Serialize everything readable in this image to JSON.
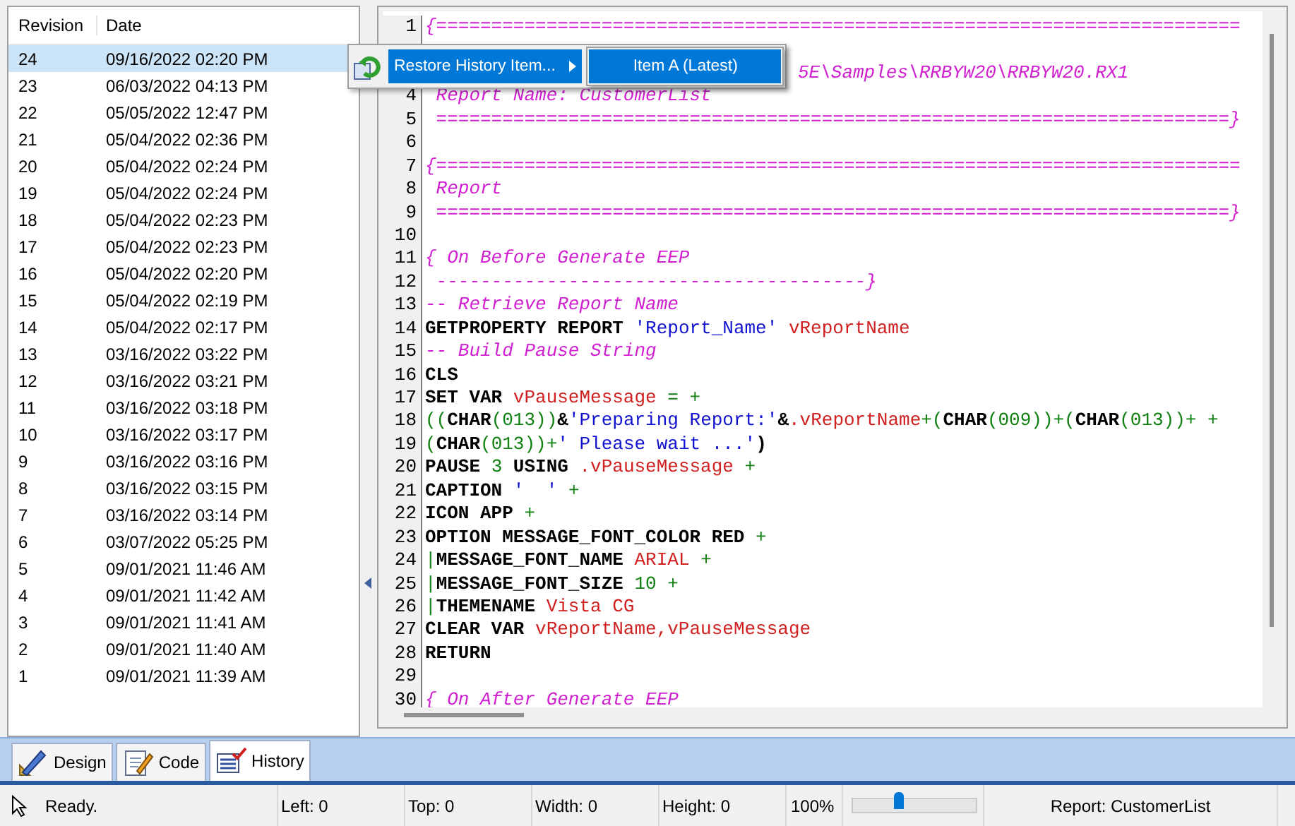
{
  "history": {
    "columns": [
      "Revision",
      "Date"
    ],
    "rows": [
      {
        "revision": "24",
        "date": "09/16/2022 02:20 PM",
        "selected": true
      },
      {
        "revision": "23",
        "date": "06/03/2022 04:13 PM",
        "selected": false
      },
      {
        "revision": "22",
        "date": "05/05/2022 12:47 PM",
        "selected": false
      },
      {
        "revision": "21",
        "date": "05/04/2022 02:36 PM",
        "selected": false
      },
      {
        "revision": "20",
        "date": "05/04/2022 02:24 PM",
        "selected": false
      },
      {
        "revision": "19",
        "date": "05/04/2022 02:24 PM",
        "selected": false
      },
      {
        "revision": "18",
        "date": "05/04/2022 02:23 PM",
        "selected": false
      },
      {
        "revision": "17",
        "date": "05/04/2022 02:23 PM",
        "selected": false
      },
      {
        "revision": "16",
        "date": "05/04/2022 02:20 PM",
        "selected": false
      },
      {
        "revision": "15",
        "date": "05/04/2022 02:19 PM",
        "selected": false
      },
      {
        "revision": "14",
        "date": "05/04/2022 02:17 PM",
        "selected": false
      },
      {
        "revision": "13",
        "date": "03/16/2022 03:22 PM",
        "selected": false
      },
      {
        "revision": "12",
        "date": "03/16/2022 03:21 PM",
        "selected": false
      },
      {
        "revision": "11",
        "date": "03/16/2022 03:18 PM",
        "selected": false
      },
      {
        "revision": "10",
        "date": "03/16/2022 03:17 PM",
        "selected": false
      },
      {
        "revision": "9",
        "date": "03/16/2022 03:16 PM",
        "selected": false
      },
      {
        "revision": "8",
        "date": "03/16/2022 03:15 PM",
        "selected": false
      },
      {
        "revision": "7",
        "date": "03/16/2022 03:14 PM",
        "selected": false
      },
      {
        "revision": "6",
        "date": "03/07/2022 05:25 PM",
        "selected": false
      },
      {
        "revision": "5",
        "date": "09/01/2021 11:46 AM",
        "selected": false
      },
      {
        "revision": "4",
        "date": "09/01/2021 11:42 AM",
        "selected": false
      },
      {
        "revision": "3",
        "date": "09/01/2021 11:41 AM",
        "selected": false
      },
      {
        "revision": "2",
        "date": "09/01/2021 11:40 AM",
        "selected": false
      },
      {
        "revision": "1",
        "date": "09/01/2021 11:39 AM",
        "selected": false
      }
    ]
  },
  "context_menu": {
    "item": "Restore History Item...",
    "selected": true,
    "submenu": [
      {
        "label": "Item A (Latest)",
        "selected": true
      }
    ]
  },
  "code_lines": [
    {
      "number": "1",
      "segments": [
        {
          "kind": "comment",
          "text": "{========================================================================="
        }
      ]
    },
    {
      "covered": true
    },
    {
      "covered": true,
      "segments": [
        {
          "kind": "comment",
          "text": "5E\\Samples\\RRBYW20\\RRBYW20.RX1"
        }
      ]
    },
    {
      "number": "4",
      "segments": [
        {
          "kind": "comment",
          "text": " Report Name: CustomerList"
        }
      ]
    },
    {
      "number": "5",
      "segments": [
        {
          "kind": "comment",
          "text": " ========================================================================}"
        }
      ]
    },
    {
      "number": "6"
    },
    {
      "number": "7",
      "segments": [
        {
          "kind": "comment",
          "text": "{========================================================================="
        }
      ]
    },
    {
      "number": "8",
      "segments": [
        {
          "kind": "comment",
          "text": " Report"
        }
      ]
    },
    {
      "number": "9",
      "segments": [
        {
          "kind": "comment",
          "text": " ========================================================================}"
        }
      ]
    },
    {
      "number": "10"
    },
    {
      "number": "11",
      "segments": [
        {
          "kind": "comment",
          "text": "{ On Before Generate EEP"
        }
      ]
    },
    {
      "number": "12",
      "segments": [
        {
          "kind": "comment",
          "text": " ---------------------------------------}"
        }
      ]
    },
    {
      "number": "13",
      "segments": [
        {
          "kind": "comment",
          "text": "-- Retrieve Report Name"
        }
      ]
    },
    {
      "number": "14",
      "segments": [
        {
          "kind": "keyword",
          "text": "GETPROPERTY REPORT "
        },
        {
          "kind": "string",
          "text": "'Report_Name'"
        },
        {
          "kind": "variable",
          "text": " vReportName"
        }
      ]
    },
    {
      "number": "15",
      "segments": [
        {
          "kind": "comment",
          "text": "-- Build Pause String"
        }
      ]
    },
    {
      "number": "16",
      "segments": [
        {
          "kind": "keyword",
          "text": "CLS"
        }
      ]
    },
    {
      "number": "17",
      "segments": [
        {
          "kind": "keyword",
          "text": "SET VAR "
        },
        {
          "kind": "variable",
          "text": "vPauseMessage"
        },
        {
          "kind": "operator",
          "text": " = +"
        }
      ]
    },
    {
      "number": "18",
      "segments": [
        {
          "kind": "operator",
          "text": "(("
        },
        {
          "kind": "keyword",
          "text": "CHAR"
        },
        {
          "kind": "operator",
          "text": "(013))"
        },
        {
          "kind": "keyword",
          "text": "&"
        },
        {
          "kind": "string",
          "text": "'Preparing Report:'"
        },
        {
          "kind": "keyword",
          "text": "&"
        },
        {
          "kind": "variable",
          "text": ".vReportName"
        },
        {
          "kind": "operator",
          "text": "+("
        },
        {
          "kind": "keyword",
          "text": "CHAR"
        },
        {
          "kind": "operator",
          "text": "(009))+("
        },
        {
          "kind": "keyword",
          "text": "CHAR"
        },
        {
          "kind": "operator",
          "text": "(013))+ +"
        }
      ]
    },
    {
      "number": "19",
      "segments": [
        {
          "kind": "operator",
          "text": "("
        },
        {
          "kind": "keyword",
          "text": "CHAR"
        },
        {
          "kind": "operator",
          "text": "(013))+"
        },
        {
          "kind": "string",
          "text": "' Please wait ...'"
        },
        {
          "kind": "keyword",
          "text": ")"
        }
      ]
    },
    {
      "number": "20",
      "segments": [
        {
          "kind": "keyword",
          "text": "PAUSE "
        },
        {
          "kind": "operator",
          "text": "3"
        },
        {
          "kind": "keyword",
          "text": " USING "
        },
        {
          "kind": "variable",
          "text": ".vPauseMessage"
        },
        {
          "kind": "operator",
          "text": " +"
        }
      ]
    },
    {
      "number": "21",
      "segments": [
        {
          "kind": "keyword",
          "text": "CAPTION "
        },
        {
          "kind": "string",
          "text": "'  '"
        },
        {
          "kind": "operator",
          "text": " +"
        }
      ]
    },
    {
      "number": "22",
      "segments": [
        {
          "kind": "keyword",
          "text": "ICON APP "
        },
        {
          "kind": "operator",
          "text": "+"
        }
      ]
    },
    {
      "number": "23",
      "segments": [
        {
          "kind": "keyword",
          "text": "OPTION MESSAGE_FONT_COLOR RED "
        },
        {
          "kind": "operator",
          "text": "+"
        }
      ]
    },
    {
      "number": "24",
      "segments": [
        {
          "kind": "operator",
          "text": "|"
        },
        {
          "kind": "keyword",
          "text": "MESSAGE_FONT_NAME "
        },
        {
          "kind": "variable",
          "text": "ARIAL"
        },
        {
          "kind": "operator",
          "text": " +"
        }
      ]
    },
    {
      "number": "25",
      "segments": [
        {
          "kind": "operator",
          "text": "|"
        },
        {
          "kind": "keyword",
          "text": "MESSAGE_FONT_SIZE "
        },
        {
          "kind": "operator",
          "text": "10 +"
        }
      ]
    },
    {
      "number": "26",
      "segments": [
        {
          "kind": "operator",
          "text": "|"
        },
        {
          "kind": "keyword",
          "text": "THEMENAME "
        },
        {
          "kind": "variable",
          "text": "Vista CG"
        }
      ]
    },
    {
      "number": "27",
      "segments": [
        {
          "kind": "keyword",
          "text": "CLEAR VAR "
        },
        {
          "kind": "variable",
          "text": "vReportName,vPauseMessage"
        }
      ]
    },
    {
      "number": "28",
      "segments": [
        {
          "kind": "keyword",
          "text": "RETURN"
        }
      ]
    },
    {
      "number": "29"
    },
    {
      "number": "30",
      "segments": [
        {
          "kind": "comment",
          "text": "{ On After Generate EEP"
        }
      ]
    }
  ],
  "tabs": [
    {
      "label": "Design",
      "selected": false
    },
    {
      "label": "Code",
      "selected": false
    },
    {
      "label": "History",
      "selected": true
    }
  ],
  "status_bar": {
    "message": "Ready.",
    "left": "Left: 0",
    "top": "Top: 0",
    "width": "Width: 0",
    "height": "Height: 0",
    "zoom": "100%",
    "zoom_slider": {
      "level": 0.38
    },
    "report": "Report: CustomerList"
  }
}
